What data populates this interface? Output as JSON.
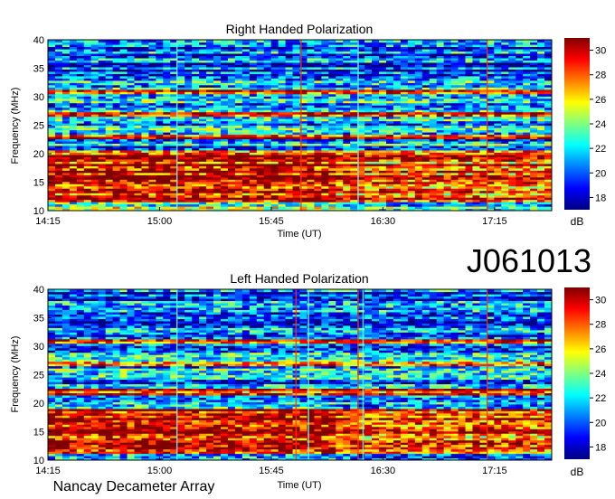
{
  "dataset_id": "J061013",
  "footer": "Nancay Decameter Array",
  "colors": {
    "colormap": [
      "#00007f",
      "#0000ff",
      "#007fff",
      "#00ffff",
      "#7fff7f",
      "#ffff00",
      "#ff7f00",
      "#ff0000",
      "#7f0000"
    ]
  },
  "chart_data": [
    {
      "type": "heatmap",
      "title": "Right Handed Polarization",
      "xlabel": "Time (UT)",
      "ylabel": "Frequency (MHz)",
      "x_ticks": [
        "14:15",
        "15:00",
        "15:45",
        "16:30",
        "17:15"
      ],
      "y_ticks": [
        10,
        15,
        20,
        25,
        30,
        35,
        40
      ],
      "ylim": [
        10,
        40
      ],
      "colorbar": {
        "unit": "dB",
        "ticks": [
          18,
          20,
          22,
          24,
          26,
          28,
          30
        ],
        "range": [
          17,
          31
        ]
      },
      "intense_bands_mhz": [
        [
          11.5,
          20.5
        ],
        [
          22.5,
          23.5
        ],
        [
          26.5,
          27.5
        ],
        [
          30.5,
          31.5
        ]
      ],
      "vertical_lines_time": [
        "15:07",
        "15:57",
        "16:20",
        "17:12"
      ]
    },
    {
      "type": "heatmap",
      "title": "Left Handed Polarization",
      "xlabel": "Time (UT)",
      "ylabel": "Frequency (MHz)",
      "x_ticks": [
        "14:15",
        "15:00",
        "15:45",
        "16:30",
        "17:15"
      ],
      "y_ticks": [
        10,
        15,
        20,
        25,
        30,
        35,
        40
      ],
      "ylim": [
        10,
        40
      ],
      "colorbar": {
        "unit": "dB",
        "ticks": [
          18,
          20,
          22,
          24,
          26,
          28,
          30
        ],
        "range": [
          17,
          31
        ]
      },
      "intense_bands_mhz": [
        [
          11,
          19
        ],
        [
          21.5,
          22.5
        ],
        [
          26.5,
          27.5
        ],
        [
          30.5,
          31.5
        ]
      ],
      "vertical_lines_time": [
        "15:07",
        "15:55",
        "16:00",
        "16:20",
        "16:22",
        "17:12"
      ]
    }
  ]
}
